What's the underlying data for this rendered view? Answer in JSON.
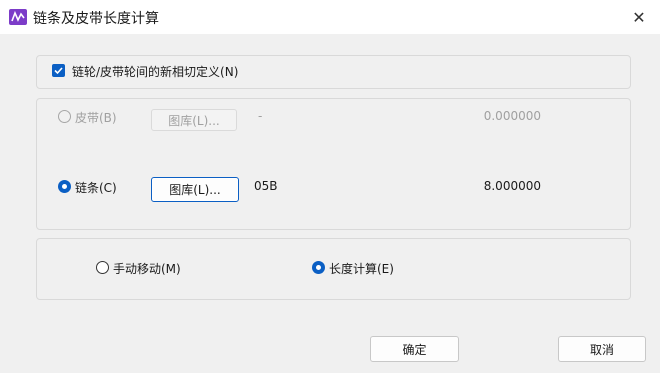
{
  "window": {
    "title": "链条及皮带长度计算",
    "close_glyph": "✕"
  },
  "colors": {
    "accent": "#0b5fc4",
    "disabled_text": "#a0a0a0"
  },
  "tangent_option": {
    "label": "链轮/皮带轮间的新相切定义(N)",
    "checked": true
  },
  "belt": {
    "label": "皮带(B)",
    "selected": false,
    "library_button": "图库(L)...",
    "spec": "-",
    "value": "0.000000"
  },
  "chain": {
    "label": "链条(C)",
    "selected": true,
    "library_button": "图库(L)...",
    "spec": "05B",
    "value": "8.000000"
  },
  "mode": {
    "manual_move": {
      "label": "手动移动(M)",
      "selected": false
    },
    "length_calc": {
      "label": "长度计算(E)",
      "selected": true
    }
  },
  "footer": {
    "ok_label": "确定",
    "cancel_label": "取消"
  }
}
